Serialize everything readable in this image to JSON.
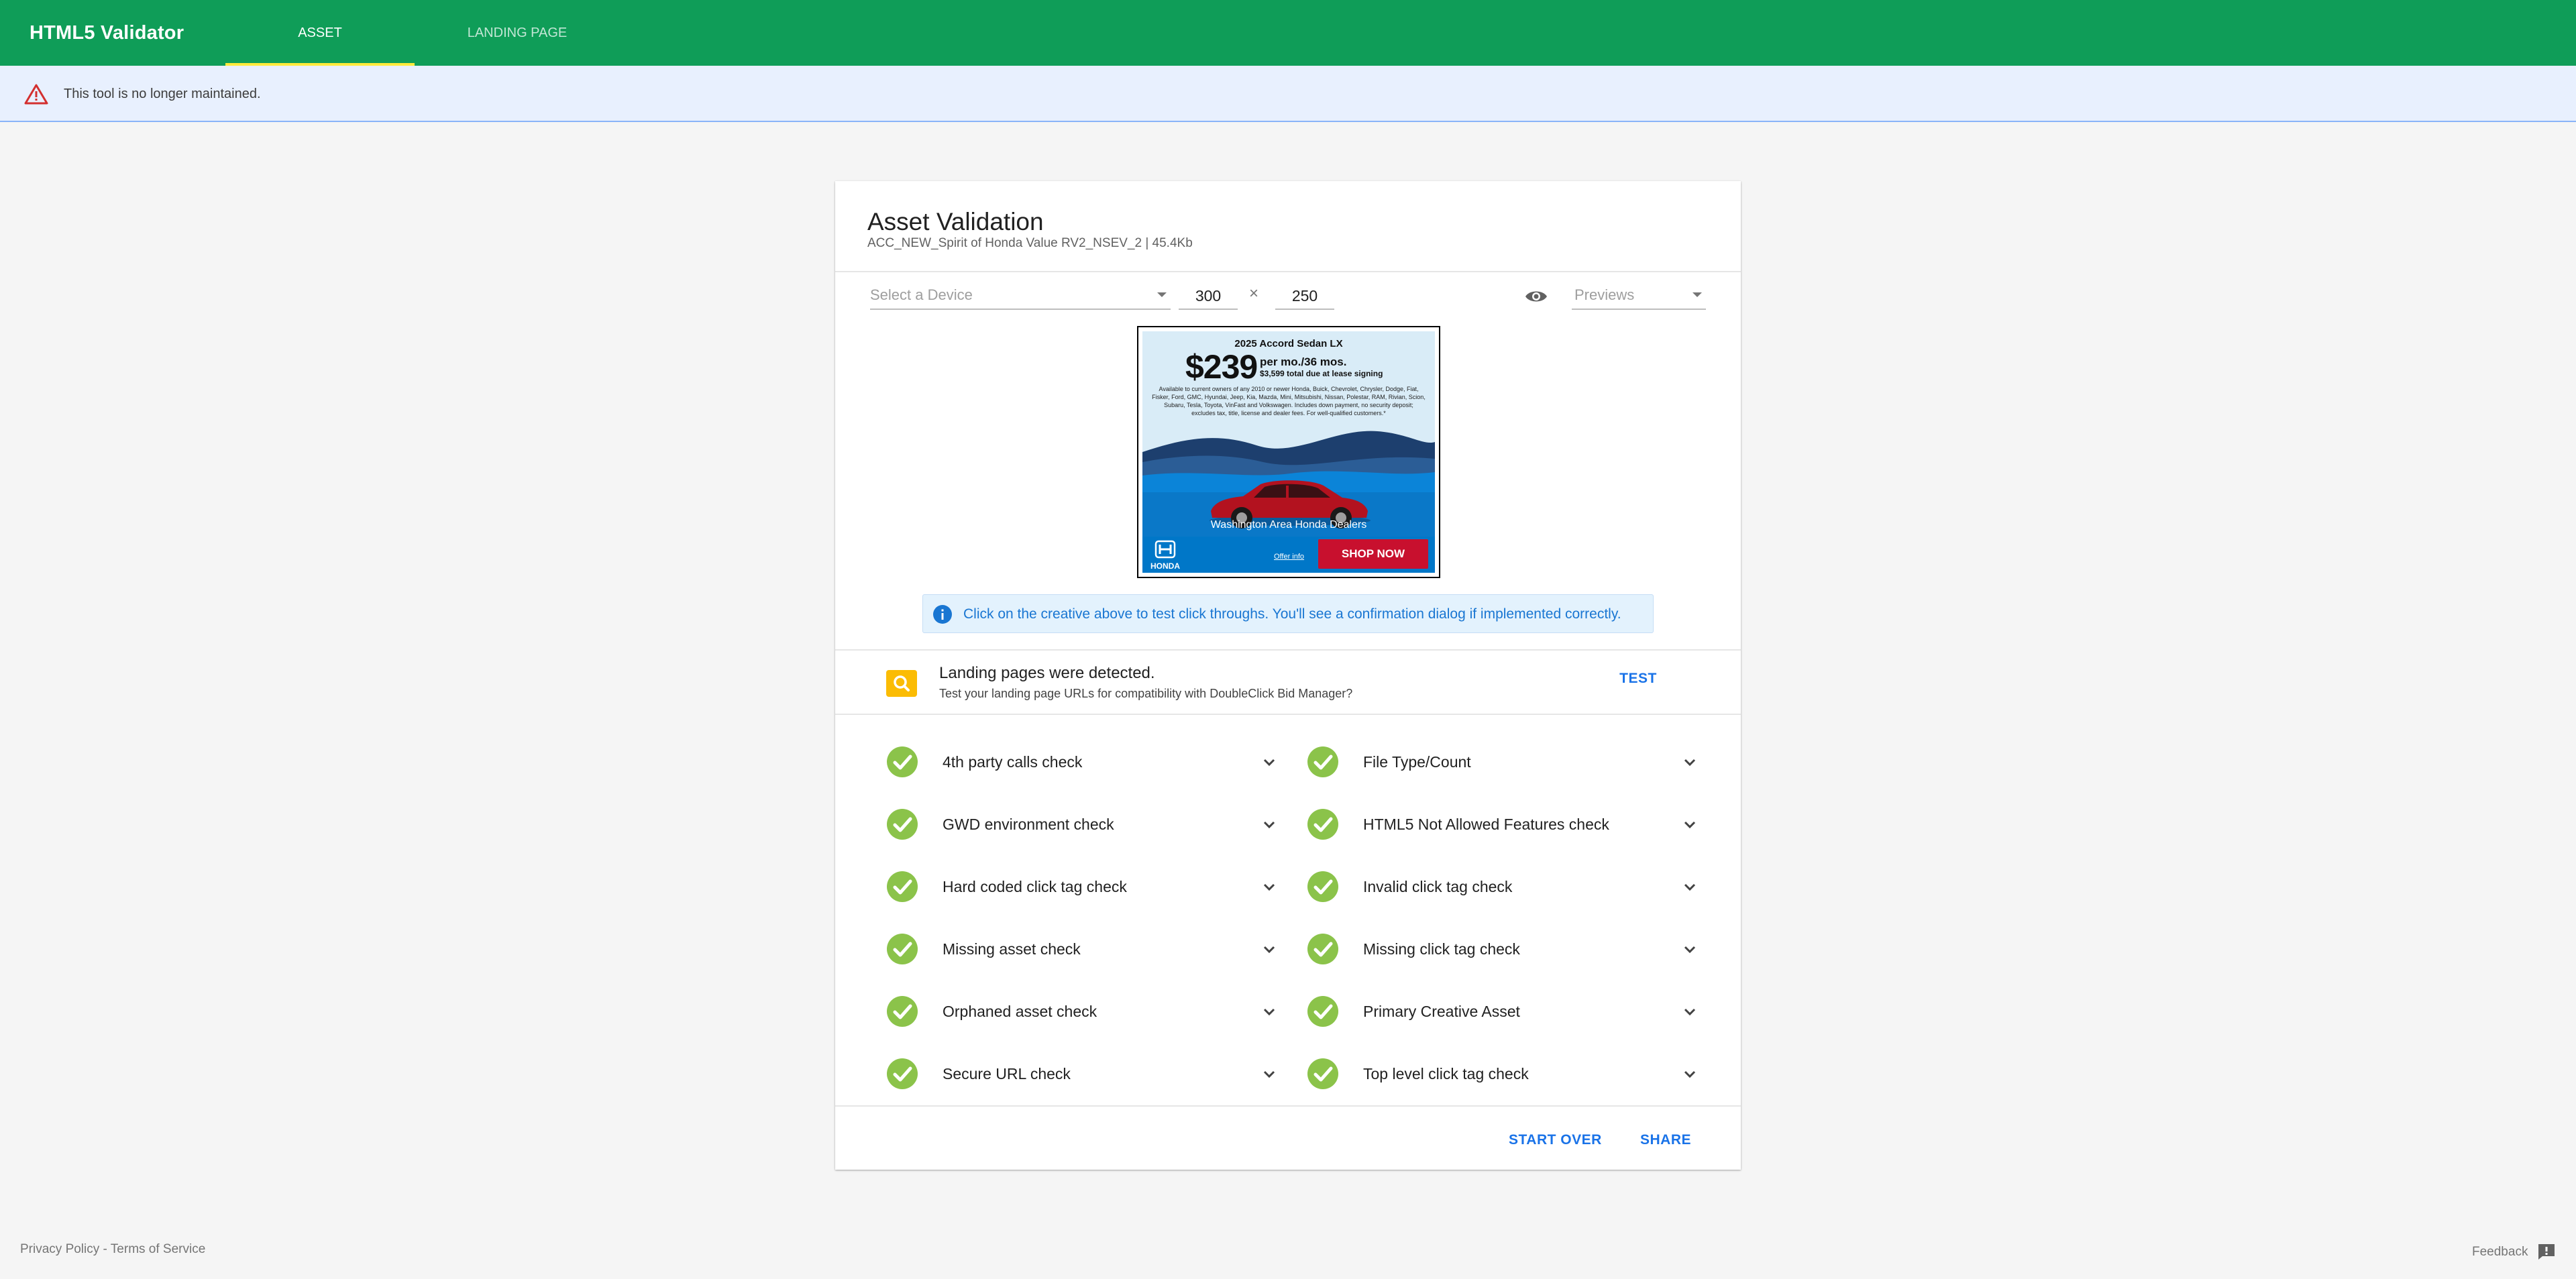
{
  "app": {
    "title": "HTML5 Validator",
    "tabs": [
      {
        "label": "ASSET",
        "active": true
      },
      {
        "label": "LANDING PAGE",
        "active": false
      }
    ]
  },
  "banner": {
    "icon": "warning-icon",
    "text": "This tool is no longer maintained."
  },
  "card": {
    "title": "Asset Validation",
    "subtitle": "ACC_NEW_Spirit of Honda Value RV2_NSEV_2 | 45.4Kb",
    "device_placeholder": "Select a Device",
    "width": "300",
    "times": "×",
    "height": "250",
    "previews_placeholder": "Previews"
  },
  "creative": {
    "model": "2025 Accord Sedan LX",
    "price": "$239",
    "per_month": "per mo./36 mos.",
    "due": "$3,599 total due at lease signing",
    "fine_print": "Available to current owners of any 2010 or newer Honda, Buick, Chevrolet, Chrysler, Dodge, Fiat, Fisker, Ford, GMC, Hyundai, Jeep, Kia, Mazda, Mini, Mitsubishi, Nissan, Polestar, RAM, Rivian, Scion, Subaru, Tesla, Toyota, VinFast and Volkswagen. Includes down payment, no security deposit; excludes tax, title, license and dealer fees. For well-qualified customers.*",
    "dealers": "Washington Area Honda Dealers",
    "brand": "HONDA",
    "offer_info": "Offer info",
    "cta": "SHOP NOW"
  },
  "info": {
    "text": "Click on the creative above to test click throughs. You'll see a confirmation dialog if implemented correctly."
  },
  "landing": {
    "title": "Landing pages were detected.",
    "description": "Test your landing page URLs for compatibility with DoubleClick Bid Manager?",
    "test_label": "TEST"
  },
  "checks": [
    {
      "label": "4th party calls check",
      "status": "passed"
    },
    {
      "label": "File Type/Count",
      "status": "passed"
    },
    {
      "label": "GWD environment check",
      "status": "passed"
    },
    {
      "label": "HTML5 Not Allowed Features check",
      "status": "passed"
    },
    {
      "label": "Hard coded click tag check",
      "status": "passed"
    },
    {
      "label": "Invalid click tag check",
      "status": "passed"
    },
    {
      "label": "Missing asset check",
      "status": "passed"
    },
    {
      "label": "Missing click tag check",
      "status": "passed"
    },
    {
      "label": "Orphaned asset check",
      "status": "passed"
    },
    {
      "label": "Primary Creative Asset",
      "status": "passed"
    },
    {
      "label": "Secure URL check",
      "status": "passed"
    },
    {
      "label": "Top level click tag check",
      "status": "passed"
    }
  ],
  "actions": {
    "start_over": "START OVER",
    "share": "SHARE"
  },
  "footer": {
    "privacy": "Privacy Policy",
    "separator": " - ",
    "terms": "Terms of Service",
    "feedback": "Feedback"
  },
  "colors": {
    "appbar": "#0f9d58",
    "tab_indicator": "#ffeb3b",
    "link_blue": "#1a73e8",
    "check_green": "#8bc34a",
    "warning_red": "#d32f2f"
  }
}
